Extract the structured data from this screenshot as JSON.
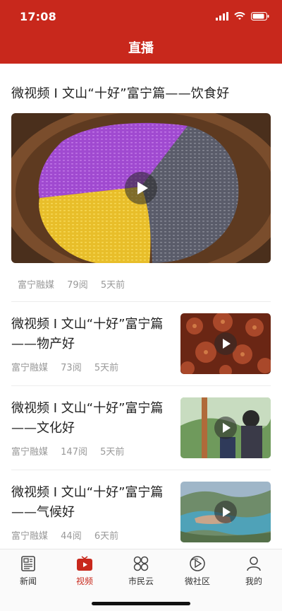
{
  "status_bar": {
    "time": "17:08"
  },
  "header": {
    "title": "直播"
  },
  "featured": {
    "title": "微视频 I 文山“十好”富宁篇——饮食好",
    "source": "富宁融媒",
    "reads": "79阅",
    "age": "5天前"
  },
  "items": [
    {
      "title": "微视频 I 文山“十好”富宁篇——物产好",
      "source": "富宁融媒",
      "reads": "73阅",
      "age": "5天前"
    },
    {
      "title": "微视频 I 文山“十好”富宁篇——文化好",
      "source": "富宁融媒",
      "reads": "147阅",
      "age": "5天前"
    },
    {
      "title": "微视频 I 文山“十好”富宁篇——气候好",
      "source": "富宁融媒",
      "reads": "44阅",
      "age": "6天前"
    }
  ],
  "tabbar": {
    "tabs": [
      {
        "label": "新闻",
        "icon": "newspaper-icon"
      },
      {
        "label": "视频",
        "icon": "video-play-icon",
        "active": true
      },
      {
        "label": "市民云",
        "icon": "four-circles-icon"
      },
      {
        "label": "微社区",
        "icon": "community-icon"
      },
      {
        "label": "我的",
        "icon": "user-icon"
      }
    ]
  },
  "colors": {
    "brand_red": "#c8281c",
    "meta_gray": "#999999"
  }
}
